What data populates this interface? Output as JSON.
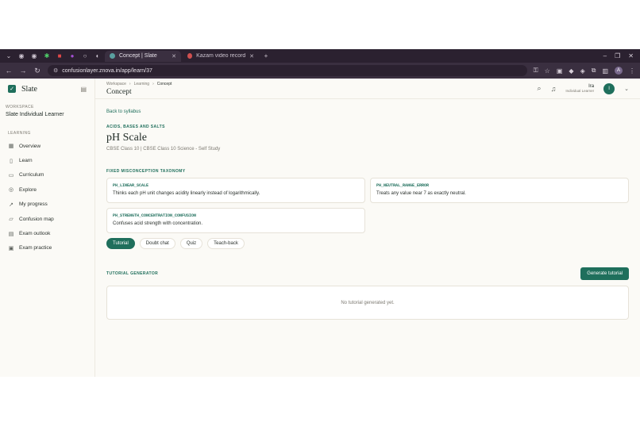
{
  "browser": {
    "tabs": [
      {
        "title": "Concept | Slate"
      },
      {
        "title": "Kazam video recording"
      }
    ],
    "url": "confusionlayer.znova.in/app/learn/37",
    "profile_initial": "A"
  },
  "sidebar": {
    "brand": "Slate",
    "workspace_label": "WORKSPACE",
    "workspace_name": "Slate Individual Learner",
    "section_label": "LEARNING",
    "items": [
      {
        "label": "Overview",
        "icon": "grid-icon"
      },
      {
        "label": "Learn",
        "icon": "book-icon"
      },
      {
        "label": "Curriculum",
        "icon": "folder-icon"
      },
      {
        "label": "Explore",
        "icon": "compass-icon"
      },
      {
        "label": "My progress",
        "icon": "trend-icon"
      },
      {
        "label": "Confusion map",
        "icon": "map-icon"
      },
      {
        "label": "Exam outlook",
        "icon": "document-icon"
      },
      {
        "label": "Exam practice",
        "icon": "clipboard-icon"
      }
    ]
  },
  "header": {
    "breadcrumbs": [
      "Workspace",
      "Learning",
      "Concept"
    ],
    "title": "Concept",
    "user_name": "Ira",
    "user_role": "Individual Learner",
    "user_initial": "I"
  },
  "content": {
    "back_label": "Back to syllabus",
    "topic": "ACIDS, BASES AND SALTS",
    "title": "pH Scale",
    "meta": "CBSE Class 10 | CBSE Class 10 Science - Self Study",
    "taxonomy_label": "FIXED MISCONCEPTION TAXONOMY",
    "misconceptions": [
      {
        "code": "PH_LINEAR_SCALE",
        "desc": "Thinks each pH unit changes acidity linearly instead of logarithmically."
      },
      {
        "code": "PH_NEUTRAL_RANGE_ERROR",
        "desc": "Treats any value near 7 as exactly neutral."
      },
      {
        "code": "PH_STRENGTH_CONCENTRATION_CONFUSION",
        "desc": "Confuses acid strength with concentration."
      }
    ],
    "tabs": [
      "Tutorial",
      "Doubt chat",
      "Quiz",
      "Teach-back"
    ],
    "active_tab": "Tutorial",
    "generator_label": "TUTORIAL GENERATOR",
    "generate_button": "Generate tutorial",
    "empty_text": "No tutorial generated yet."
  },
  "colors": {
    "accent": "#1f6f5c",
    "browser_dark": "#2b2130"
  }
}
